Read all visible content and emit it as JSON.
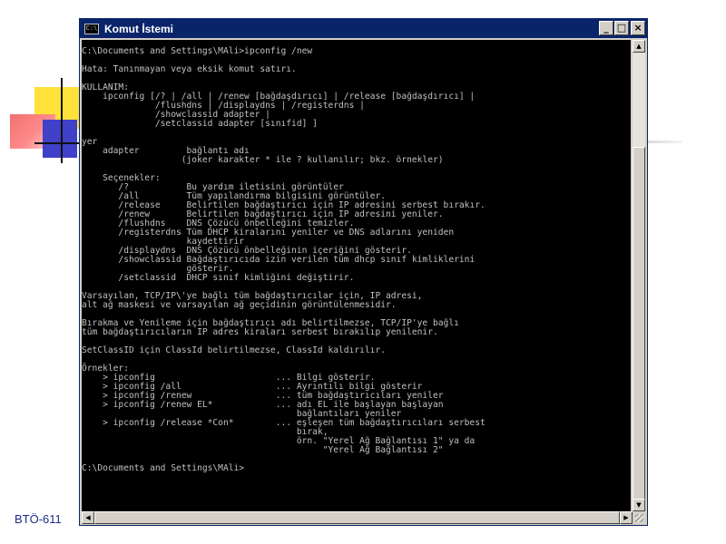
{
  "window": {
    "title": "Komut İstemi",
    "icon_text": "C:\\",
    "buttons": {
      "minimize": "_",
      "maximize": "□",
      "close": "×"
    }
  },
  "console": {
    "lines": [
      "C:\\Documents and Settings\\MAli>ipconfig /new",
      "",
      "Hata: Tanınmayan veya eksik komut satırı.",
      "",
      "KULLANIM:",
      "    ipconfig [/? | /all | /renew [bağdaşdırıcı] | /release [bağdaşdırıcı] |",
      "              /flushdns | /displaydns | /registerdns |",
      "              /showclassid adapter |",
      "              /setclassid adapter [sınıfid] ]",
      "",
      "yer",
      "    adapter         bağlantı adı",
      "                   (joker karakter * ile ? kullanılır; bkz. örnekler)",
      "",
      "    Seçenekler:",
      "       /?           Bu yardım iletisini görüntüler",
      "       /all         Tüm yapılandırma bilgisini görüntüler.",
      "       /release     Belirtilen bağdaştırıcı için IP adresini serbest bırakır.",
      "       /renew       Belirtilen bağdaştırıcı için IP adresini yeniler.",
      "       /flushdns    DNS Çözücü önbelleğini temizler.",
      "       /registerdns Tüm DHCP kiralarını yeniler ve DNS adlarını yeniden",
      "                    kaydettirir",
      "       /displaydns  DNS Çözücü önbelleğinin içeriğini gösterir.",
      "       /showclassid Bağdaştırıcıda izin verilen tüm dhcp sınıf kimliklerini",
      "                    gösterir.",
      "       /setclassid  DHCP sınıf kimliğini değiştirir.",
      "",
      "Varsayılan, TCP/IP\\'ye bağlı tüm bağdaştırıcılar için, IP adresi,",
      "alt ağ maskesi ve varsayılan ağ geçidinin görüntülenmesidir.",
      "",
      "Bırakma ve Yenileme için bağdaştırıcı adı belirtilmezse, TCP/IP'ye bağlı",
      "tüm bağdaştırıcıların IP adres kiraları serbest bırakılıp yenilenir.",
      "",
      "SetClassID için ClassId belirtilmezse, ClassId kaldırılır.",
      "",
      "Örnekler:",
      "    > ipconfig                       ... Bilgi gösterir.",
      "    > ipconfig /all                  ... Ayrıntılı bilgi gösterir",
      "    > ipconfig /renew                ... tüm bağdaştırıcıları yeniler",
      "    > ipconfig /renew EL*            ... adı EL ile başlayan başlayan",
      "                                         bağlantıları yeniler",
      "    > ipconfig /release *Con*        ... eşleşen tüm bağdaştırıcıları serbest",
      "                                         bırak,",
      "                                         örn. \"Yerel Ağ Bağlantısı 1\" ya da",
      "                                              \"Yerel Ağ Bağlantısı 2\"",
      "",
      "C:\\Documents and Settings\\MAli>"
    ]
  },
  "scrollbar": {
    "up_arrow": "▲",
    "down_arrow": "▼",
    "left_arrow": "◀",
    "right_arrow": "▶"
  },
  "footer": {
    "label": "BTÖ-611"
  }
}
